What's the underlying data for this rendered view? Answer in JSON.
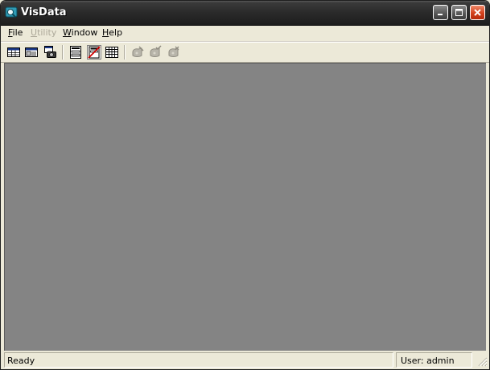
{
  "window": {
    "title": "VisData",
    "controls": {
      "minimize": "minimize",
      "maximize": "maximize",
      "close": "close"
    }
  },
  "menu": {
    "items": [
      {
        "accel": "F",
        "rest": "ile",
        "enabled": true
      },
      {
        "accel": "U",
        "rest": "tility",
        "enabled": false
      },
      {
        "accel": "W",
        "rest": "indow",
        "enabled": true
      },
      {
        "accel": "H",
        "rest": "elp",
        "enabled": true
      }
    ]
  },
  "toolbar": {
    "buttons": [
      {
        "icon": "table-type-icon",
        "enabled": true,
        "pressed": false
      },
      {
        "icon": "dynaset-type-icon",
        "enabled": true,
        "pressed": false
      },
      {
        "icon": "snapshot-type-icon",
        "enabled": true,
        "pressed": false
      },
      {
        "icon": "data-control-form-icon",
        "enabled": true,
        "pressed": false
      },
      {
        "icon": "no-data-control-form-icon",
        "enabled": true,
        "pressed": true
      },
      {
        "icon": "grid-form-icon",
        "enabled": true,
        "pressed": false
      },
      {
        "icon": "begin-transaction-icon",
        "enabled": false,
        "pressed": false
      },
      {
        "icon": "commit-transaction-icon",
        "enabled": false,
        "pressed": false
      },
      {
        "icon": "rollback-transaction-icon",
        "enabled": false,
        "pressed": false
      }
    ]
  },
  "statusbar": {
    "status": "Ready",
    "user": "User: admin"
  },
  "colors": {
    "mdi_background": "#848484",
    "titlebar": "#2a2a2a",
    "chrome": "#ece9d8",
    "close_button": "#d3401c"
  }
}
